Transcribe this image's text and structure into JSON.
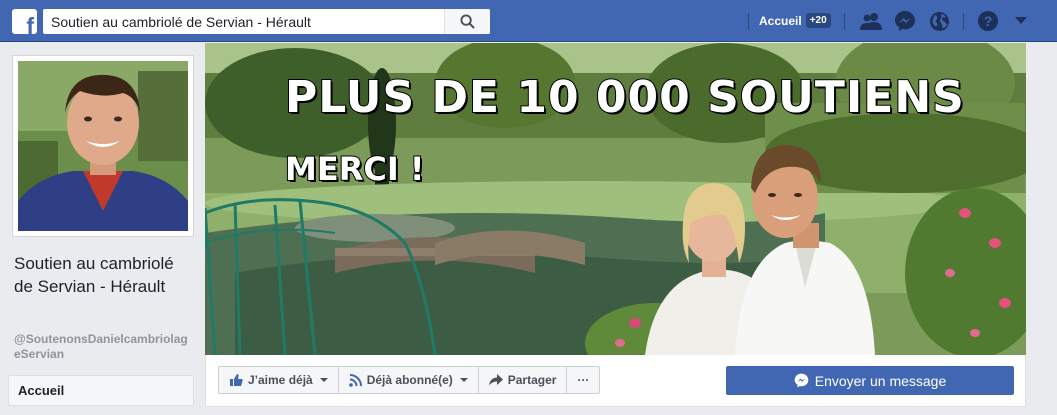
{
  "topbar": {
    "logo": "f",
    "search_value": "Soutien au cambriolé de Servian - Hérault",
    "home_label": "Accueil",
    "home_badge": "+20",
    "icons": [
      "friends-icon",
      "messenger-icon",
      "globe-icon",
      "help-icon",
      "chevron-down-icon"
    ],
    "color": "#4267b2"
  },
  "page": {
    "name": "Soutien au cambriolé de Servian - Hérault",
    "handle": "@SoutenonsDanielcambriolageServian",
    "nav_active": "Accueil"
  },
  "cover": {
    "headline": "PLUS DE 10 000 SOUTIENS",
    "subline": "MERCI !"
  },
  "actions": {
    "like_label": "J’aime déjà",
    "follow_label": "Déjà abonné(e)",
    "share_label": "Partager",
    "more_label": "···",
    "message_label": "Envoyer un message"
  }
}
